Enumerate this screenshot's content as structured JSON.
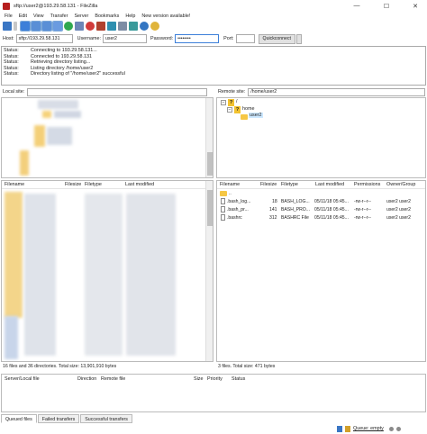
{
  "window": {
    "title": "sftp://user2@193.29.58.131 - FileZilla",
    "controls": {
      "minimize": "—",
      "maximize": "☐",
      "close": "✕"
    }
  },
  "menu": [
    "File",
    "Edit",
    "View",
    "Transfer",
    "Server",
    "Bookmarks",
    "Help",
    "New version available!"
  ],
  "quickconnect": {
    "host_label": "Host:",
    "host_value": "sftp://193.29.58.131",
    "user_label": "Username:",
    "user_value": "user2",
    "pass_label": "Password:",
    "pass_value": "••••••••",
    "port_label": "Port:",
    "port_value": "",
    "button": "Quickconnect"
  },
  "log": [
    {
      "k": "Status:",
      "v": "Connecting to 193.29.58.131..."
    },
    {
      "k": "Status:",
      "v": "Connected to 193.29.58.131"
    },
    {
      "k": "Status:",
      "v": "Retrieving directory listing..."
    },
    {
      "k": "Status:",
      "v": "Listing directory /home/user2"
    },
    {
      "k": "Status:",
      "v": "Directory listing of \"/home/user2\" successful"
    }
  ],
  "local": {
    "site_label": "Local site:",
    "path": "",
    "columns": [
      "Filename",
      "Filesize",
      "Filetype",
      "Last modified"
    ],
    "status": "16 files and 36 directories. Total size: 13,901,910 bytes"
  },
  "remote": {
    "site_label": "Remote site:",
    "path": "/home/user2",
    "tree": [
      "/",
      "home",
      "user2"
    ],
    "tree_unknown": [
      "?",
      "?"
    ],
    "columns": [
      "Filename",
      "Filesize",
      "Filetype",
      "Last modified",
      "Permissions",
      "Owner/Group"
    ],
    "files": [
      {
        "name": "..",
        "size": "",
        "type": "",
        "modified": "",
        "perms": "",
        "owner": ""
      },
      {
        "name": ".bash_log...",
        "size": "18",
        "type": "BASH_LOG...",
        "modified": "05/11/18 05:45...",
        "perms": "-rw-r--r--",
        "owner": "user2 user2"
      },
      {
        "name": ".bash_pr...",
        "size": "141",
        "type": "BASH_PRO...",
        "modified": "05/11/18 05:45...",
        "perms": "-rw-r--r--",
        "owner": "user2 user2"
      },
      {
        "name": ".bashrc",
        "size": "312",
        "type": "BASHRC File",
        "modified": "05/11/18 05:45...",
        "perms": "-rw-r--r--",
        "owner": "user2 user2"
      }
    ],
    "status": "3 files. Total size: 471 bytes"
  },
  "queue": {
    "columns": [
      "Server/Local file",
      "Direction",
      "Remote file",
      "Size",
      "Priority",
      "Status"
    ],
    "tabs": [
      "Queued files",
      "Failed transfers",
      "Successful transfers"
    ],
    "status": "Queue: empty"
  },
  "colors": {
    "folder": "#f6c744",
    "accent": "#3c7fd9"
  }
}
